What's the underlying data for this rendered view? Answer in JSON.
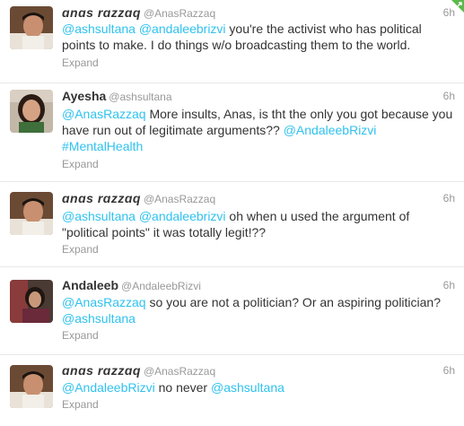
{
  "tweets": [
    {
      "name": "ɑnɑs rɑzzɑq",
      "handle": "@AnasRazzaq",
      "time": "6h",
      "segments": [
        {
          "type": "mention",
          "text": "@ashsultana"
        },
        {
          "type": "text",
          "text": " "
        },
        {
          "type": "mention",
          "text": "@andaleebrizvi"
        },
        {
          "type": "text",
          "text": " you're the activist who has political points to make. I do things w/o broadcasting them to the world."
        }
      ],
      "expand": "Expand",
      "avatar": "man-avatar-icon"
    },
    {
      "name": "Ayesha",
      "handle": "@ashsultana",
      "time": "6h",
      "segments": [
        {
          "type": "mention",
          "text": "@AnasRazzaq"
        },
        {
          "type": "text",
          "text": " More insults, Anas, is tht the only you got because you have run out of legitimate arguments?? "
        },
        {
          "type": "mention",
          "text": "@AndaleebRizvi"
        },
        {
          "type": "text",
          "text": " "
        },
        {
          "type": "hashtag",
          "text": "#MentalHealth"
        }
      ],
      "expand": "Expand",
      "avatar": "woman-avatar-icon"
    },
    {
      "name": "ɑnɑs rɑzzɑq",
      "handle": "@AnasRazzaq",
      "time": "6h",
      "segments": [
        {
          "type": "mention",
          "text": "@ashsultana"
        },
        {
          "type": "text",
          "text": " "
        },
        {
          "type": "mention",
          "text": "@andaleebrizvi"
        },
        {
          "type": "text",
          "text": " oh when u used the argument of \"political points\" it was totally legit!??"
        }
      ],
      "expand": "Expand",
      "avatar": "man-avatar-icon"
    },
    {
      "name": "Andaleeb",
      "handle": "@AndaleebRizvi",
      "time": "6h",
      "segments": [
        {
          "type": "mention",
          "text": "@AnasRazzaq"
        },
        {
          "type": "text",
          "text": " so you are not a politician? Or an aspiring politician? "
        },
        {
          "type": "mention",
          "text": "@ashsultana"
        }
      ],
      "expand": "Expand",
      "avatar": "woman-avatar-icon"
    },
    {
      "name": "ɑnɑs rɑzzɑq",
      "handle": "@AnasRazzaq",
      "time": "6h",
      "segments": [
        {
          "type": "mention",
          "text": "@AndaleebRizvi"
        },
        {
          "type": "text",
          "text": " no never "
        },
        {
          "type": "mention",
          "text": "@ashsultana"
        }
      ],
      "expand": "Expand",
      "avatar": "man-avatar-icon"
    }
  ],
  "colors": {
    "mention": "#2fc2ef",
    "name": "#333333",
    "meta": "#999999",
    "corner_badge": "#5bb94b"
  },
  "corner_icon": "retweet-badge-icon"
}
